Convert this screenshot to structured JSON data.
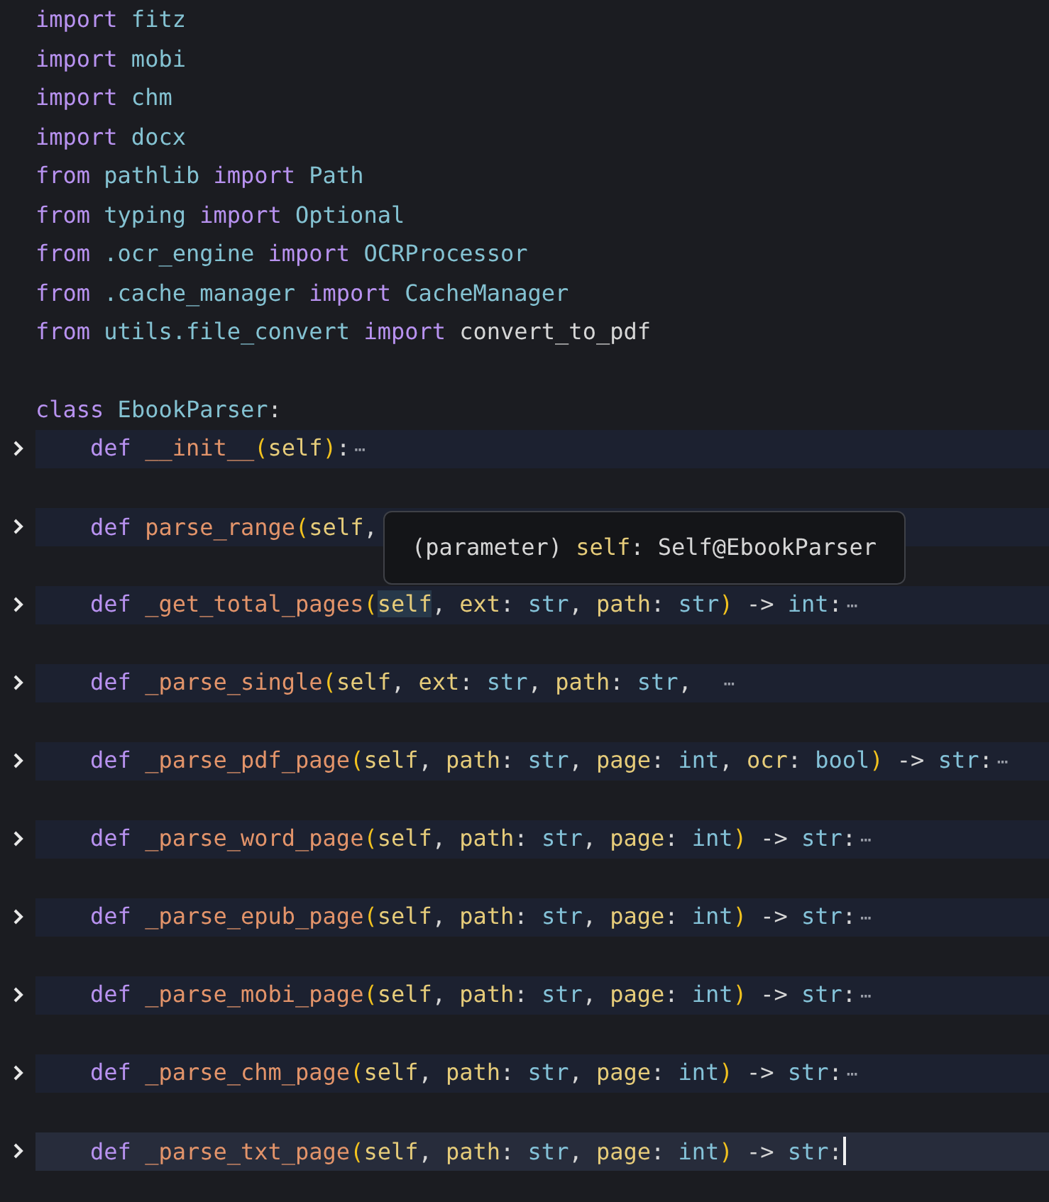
{
  "editor": {
    "lines": [
      {
        "kind": "code",
        "folded": false,
        "current": false,
        "tokens": [
          {
            "text": "import",
            "kind": "kw"
          },
          {
            "text": " fitz",
            "kind": "mod"
          }
        ]
      },
      {
        "kind": "code",
        "folded": false,
        "current": false,
        "tokens": [
          {
            "text": "import",
            "kind": "kw"
          },
          {
            "text": " mobi",
            "kind": "mod"
          }
        ]
      },
      {
        "kind": "code",
        "folded": false,
        "current": false,
        "tokens": [
          {
            "text": "import",
            "kind": "kw"
          },
          {
            "text": " chm",
            "kind": "mod"
          }
        ]
      },
      {
        "kind": "code",
        "folded": false,
        "current": false,
        "tokens": [
          {
            "text": "import",
            "kind": "kw"
          },
          {
            "text": " docx",
            "kind": "mod"
          }
        ]
      },
      {
        "kind": "code",
        "folded": false,
        "current": false,
        "tokens": [
          {
            "text": "from",
            "kind": "kw"
          },
          {
            "text": " pathlib ",
            "kind": "mod"
          },
          {
            "text": "import",
            "kind": "kw"
          },
          {
            "text": " Path",
            "kind": "mod"
          }
        ]
      },
      {
        "kind": "code",
        "folded": false,
        "current": false,
        "tokens": [
          {
            "text": "from",
            "kind": "kw"
          },
          {
            "text": " typing ",
            "kind": "mod"
          },
          {
            "text": "import",
            "kind": "kw"
          },
          {
            "text": " Optional",
            "kind": "mod"
          }
        ]
      },
      {
        "kind": "code",
        "folded": false,
        "current": false,
        "tokens": [
          {
            "text": "from",
            "kind": "kw"
          },
          {
            "text": " .ocr_engine ",
            "kind": "mod"
          },
          {
            "text": "import",
            "kind": "kw"
          },
          {
            "text": " OCRProcessor",
            "kind": "mod"
          }
        ]
      },
      {
        "kind": "code",
        "folded": false,
        "current": false,
        "tokens": [
          {
            "text": "from",
            "kind": "kw"
          },
          {
            "text": " .cache_manager ",
            "kind": "mod"
          },
          {
            "text": "import",
            "kind": "kw"
          },
          {
            "text": " CacheManager",
            "kind": "mod"
          }
        ]
      },
      {
        "kind": "code",
        "folded": false,
        "current": false,
        "tokens": [
          {
            "text": "from",
            "kind": "kw"
          },
          {
            "text": " utils.file_convert ",
            "kind": "mod"
          },
          {
            "text": "import",
            "kind": "kw"
          },
          {
            "text": " convert_to_pdf",
            "kind": "plain"
          }
        ]
      },
      {
        "kind": "blank"
      },
      {
        "kind": "code",
        "folded": false,
        "current": false,
        "tokens": [
          {
            "text": "class",
            "kind": "kw"
          },
          {
            "text": " EbookParser",
            "kind": "mod"
          },
          {
            "text": ":",
            "kind": "plain"
          }
        ]
      },
      {
        "kind": "code",
        "folded": true,
        "current": false,
        "tokens": [
          {
            "text": "    def",
            "kind": "kw"
          },
          {
            "text": " __init__",
            "kind": "fn"
          },
          {
            "text": "(",
            "kind": "paren"
          },
          {
            "text": "self",
            "kind": "param"
          },
          {
            "text": ")",
            "kind": "paren"
          },
          {
            "text": ":",
            "kind": "plain"
          },
          {
            "text": "⋯",
            "kind": "fold"
          }
        ]
      },
      {
        "kind": "blank"
      },
      {
        "kind": "code",
        "folded": true,
        "current": false,
        "tokens": [
          {
            "text": "    def",
            "kind": "kw"
          },
          {
            "text": " parse_range",
            "kind": "fn"
          },
          {
            "text": "(",
            "kind": "paren"
          },
          {
            "text": "self",
            "kind": "param"
          },
          {
            "text": ",",
            "kind": "plain"
          }
        ],
        "tooltip": [
          {
            "text": "(parameter) ",
            "kind": "plain"
          },
          {
            "text": "self",
            "kind": "param"
          },
          {
            "text": ": Self@EbookParser",
            "kind": "plain"
          }
        ]
      },
      {
        "kind": "blank"
      },
      {
        "kind": "code",
        "folded": true,
        "current": false,
        "tokens": [
          {
            "text": "    def",
            "kind": "kw"
          },
          {
            "text": " _get_total_pages",
            "kind": "fn"
          },
          {
            "text": "(",
            "kind": "paren"
          },
          {
            "text": "self",
            "kind": "param-match"
          },
          {
            "text": ", ",
            "kind": "plain"
          },
          {
            "text": "ext",
            "kind": "param"
          },
          {
            "text": ": ",
            "kind": "plain"
          },
          {
            "text": "str",
            "kind": "type"
          },
          {
            "text": ", ",
            "kind": "plain"
          },
          {
            "text": "path",
            "kind": "param"
          },
          {
            "text": ": ",
            "kind": "plain"
          },
          {
            "text": "str",
            "kind": "type"
          },
          {
            "text": ")",
            "kind": "paren"
          },
          {
            "text": " -> ",
            "kind": "plain"
          },
          {
            "text": "int",
            "kind": "type"
          },
          {
            "text": ":",
            "kind": "plain"
          },
          {
            "text": "⋯",
            "kind": "fold"
          }
        ]
      },
      {
        "kind": "blank"
      },
      {
        "kind": "code",
        "folded": true,
        "current": false,
        "tokens": [
          {
            "text": "    def",
            "kind": "kw"
          },
          {
            "text": " _parse_single",
            "kind": "fn"
          },
          {
            "text": "(",
            "kind": "paren"
          },
          {
            "text": "self",
            "kind": "param"
          },
          {
            "text": ", ",
            "kind": "plain"
          },
          {
            "text": "ext",
            "kind": "param"
          },
          {
            "text": ": ",
            "kind": "plain"
          },
          {
            "text": "str",
            "kind": "type"
          },
          {
            "text": ", ",
            "kind": "plain"
          },
          {
            "text": "path",
            "kind": "param"
          },
          {
            "text": ": ",
            "kind": "plain"
          },
          {
            "text": "str",
            "kind": "type"
          },
          {
            "text": ",  ",
            "kind": "plain"
          },
          {
            "text": "⋯",
            "kind": "fold"
          }
        ]
      },
      {
        "kind": "blank"
      },
      {
        "kind": "code",
        "folded": true,
        "current": false,
        "tokens": [
          {
            "text": "    def",
            "kind": "kw"
          },
          {
            "text": " _parse_pdf_page",
            "kind": "fn"
          },
          {
            "text": "(",
            "kind": "paren"
          },
          {
            "text": "self",
            "kind": "param"
          },
          {
            "text": ", ",
            "kind": "plain"
          },
          {
            "text": "path",
            "kind": "param"
          },
          {
            "text": ": ",
            "kind": "plain"
          },
          {
            "text": "str",
            "kind": "type"
          },
          {
            "text": ", ",
            "kind": "plain"
          },
          {
            "text": "page",
            "kind": "param"
          },
          {
            "text": ": ",
            "kind": "plain"
          },
          {
            "text": "int",
            "kind": "type"
          },
          {
            "text": ", ",
            "kind": "plain"
          },
          {
            "text": "ocr",
            "kind": "param"
          },
          {
            "text": ": ",
            "kind": "plain"
          },
          {
            "text": "bool",
            "kind": "type"
          },
          {
            "text": ")",
            "kind": "paren"
          },
          {
            "text": " -> ",
            "kind": "plain"
          },
          {
            "text": "str",
            "kind": "type"
          },
          {
            "text": ":",
            "kind": "plain"
          },
          {
            "text": "⋯",
            "kind": "fold"
          }
        ]
      },
      {
        "kind": "blank"
      },
      {
        "kind": "code",
        "folded": true,
        "current": false,
        "tokens": [
          {
            "text": "    def",
            "kind": "kw"
          },
          {
            "text": " _parse_word_page",
            "kind": "fn"
          },
          {
            "text": "(",
            "kind": "paren"
          },
          {
            "text": "self",
            "kind": "param"
          },
          {
            "text": ", ",
            "kind": "plain"
          },
          {
            "text": "path",
            "kind": "param"
          },
          {
            "text": ": ",
            "kind": "plain"
          },
          {
            "text": "str",
            "kind": "type"
          },
          {
            "text": ", ",
            "kind": "plain"
          },
          {
            "text": "page",
            "kind": "param"
          },
          {
            "text": ": ",
            "kind": "plain"
          },
          {
            "text": "int",
            "kind": "type"
          },
          {
            "text": ")",
            "kind": "paren"
          },
          {
            "text": " -> ",
            "kind": "plain"
          },
          {
            "text": "str",
            "kind": "type"
          },
          {
            "text": ":",
            "kind": "plain"
          },
          {
            "text": "⋯",
            "kind": "fold"
          }
        ]
      },
      {
        "kind": "blank"
      },
      {
        "kind": "code",
        "folded": true,
        "current": false,
        "tokens": [
          {
            "text": "    def",
            "kind": "kw"
          },
          {
            "text": " _parse_epub_page",
            "kind": "fn"
          },
          {
            "text": "(",
            "kind": "paren"
          },
          {
            "text": "self",
            "kind": "param"
          },
          {
            "text": ", ",
            "kind": "plain"
          },
          {
            "text": "path",
            "kind": "param"
          },
          {
            "text": ": ",
            "kind": "plain"
          },
          {
            "text": "str",
            "kind": "type"
          },
          {
            "text": ", ",
            "kind": "plain"
          },
          {
            "text": "page",
            "kind": "param"
          },
          {
            "text": ": ",
            "kind": "plain"
          },
          {
            "text": "int",
            "kind": "type"
          },
          {
            "text": ")",
            "kind": "paren"
          },
          {
            "text": " -> ",
            "kind": "plain"
          },
          {
            "text": "str",
            "kind": "type"
          },
          {
            "text": ":",
            "kind": "plain"
          },
          {
            "text": "⋯",
            "kind": "fold"
          }
        ]
      },
      {
        "kind": "blank"
      },
      {
        "kind": "code",
        "folded": true,
        "current": false,
        "tokens": [
          {
            "text": "    def",
            "kind": "kw"
          },
          {
            "text": " _parse_mobi_page",
            "kind": "fn"
          },
          {
            "text": "(",
            "kind": "paren"
          },
          {
            "text": "self",
            "kind": "param"
          },
          {
            "text": ", ",
            "kind": "plain"
          },
          {
            "text": "path",
            "kind": "param"
          },
          {
            "text": ": ",
            "kind": "plain"
          },
          {
            "text": "str",
            "kind": "type"
          },
          {
            "text": ", ",
            "kind": "plain"
          },
          {
            "text": "page",
            "kind": "param"
          },
          {
            "text": ": ",
            "kind": "plain"
          },
          {
            "text": "int",
            "kind": "type"
          },
          {
            "text": ")",
            "kind": "paren"
          },
          {
            "text": " -> ",
            "kind": "plain"
          },
          {
            "text": "str",
            "kind": "type"
          },
          {
            "text": ":",
            "kind": "plain"
          },
          {
            "text": "⋯",
            "kind": "fold"
          }
        ]
      },
      {
        "kind": "blank"
      },
      {
        "kind": "code",
        "folded": true,
        "current": false,
        "tokens": [
          {
            "text": "    def",
            "kind": "kw"
          },
          {
            "text": " _parse_chm_page",
            "kind": "fn"
          },
          {
            "text": "(",
            "kind": "paren"
          },
          {
            "text": "self",
            "kind": "param"
          },
          {
            "text": ", ",
            "kind": "plain"
          },
          {
            "text": "path",
            "kind": "param"
          },
          {
            "text": ": ",
            "kind": "plain"
          },
          {
            "text": "str",
            "kind": "type"
          },
          {
            "text": ", ",
            "kind": "plain"
          },
          {
            "text": "page",
            "kind": "param"
          },
          {
            "text": ": ",
            "kind": "plain"
          },
          {
            "text": "int",
            "kind": "type"
          },
          {
            "text": ")",
            "kind": "paren"
          },
          {
            "text": " -> ",
            "kind": "plain"
          },
          {
            "text": "str",
            "kind": "type"
          },
          {
            "text": ":",
            "kind": "plain"
          },
          {
            "text": "⋯",
            "kind": "fold"
          }
        ]
      },
      {
        "kind": "blank"
      },
      {
        "kind": "code",
        "folded": true,
        "current": true,
        "cursor": true,
        "tokens": [
          {
            "text": "    def",
            "kind": "kw"
          },
          {
            "text": " _parse_txt_page",
            "kind": "fn"
          },
          {
            "text": "(",
            "kind": "paren"
          },
          {
            "text": "self",
            "kind": "param"
          },
          {
            "text": ", ",
            "kind": "plain"
          },
          {
            "text": "path",
            "kind": "param"
          },
          {
            "text": ": ",
            "kind": "plain"
          },
          {
            "text": "str",
            "kind": "type"
          },
          {
            "text": ", ",
            "kind": "plain"
          },
          {
            "text": "page",
            "kind": "param"
          },
          {
            "text": ": ",
            "kind": "plain"
          },
          {
            "text": "int",
            "kind": "type"
          },
          {
            "text": ")",
            "kind": "paren"
          },
          {
            "text": " -> ",
            "kind": "plain"
          },
          {
            "text": "str",
            "kind": "type"
          },
          {
            "text": ":",
            "kind": "plain"
          }
        ]
      }
    ]
  }
}
